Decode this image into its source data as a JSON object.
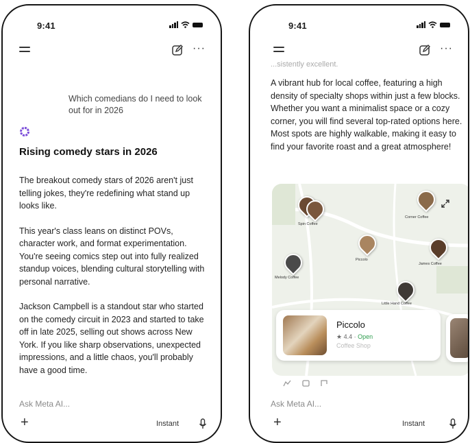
{
  "left_phone": {
    "status_time": "9:41",
    "query": "Which comedians do I need to look out for in 2026",
    "response_title": "Rising comedy stars in 2026",
    "paragraph_1": "The breakout comedy stars of 2026 aren't just telling jokes, they're redefining what stand up looks like.",
    "paragraph_2": "This year's class leans on distinct POVs, character work, and format experimentation. You're seeing comics step out into fully realized standup voices, blending cultural storytelling with personal narrative.",
    "paragraph_3_name": "Jackson Campbell",
    "paragraph_3_rest": " is a standout star who started on the comedy circuit in 2023 and started to take off in late 2025, selling out shows across New York. If you like sharp observations, unexpected impressions, and a little chaos, you'll probably have a good time.",
    "ask_placeholder": "Ask Meta AI...",
    "mode_label": "Instant"
  },
  "right_phone": {
    "status_time": "9:41",
    "faded_text": "...sistently excellent.",
    "description": "A vibrant hub for local coffee, featuring a high density of specialty shops within just a few blocks. Whether you want a minimalist space or a cozy corner, you will find several top-rated options here. Most spots are highly walkable, making it easy to find your favorite roast and a great atmosphere!",
    "map_pins": [
      {
        "label": "Spin Coffee",
        "color": "#6b4a33"
      },
      {
        "label": "Corner Coffee",
        "color": "#8a6a4a"
      },
      {
        "label": "Piccolo",
        "color": "#a98560"
      },
      {
        "label": "James Coffee",
        "color": "#5a3d2a"
      },
      {
        "label": "Melody Coffee",
        "color": "#4a4a4a"
      },
      {
        "label": "Little Hand Coffee",
        "color": "#3f3a36"
      }
    ],
    "card": {
      "name": "Piccolo",
      "rating": "★ 4.4 ·",
      "status": "Open",
      "category": "Coffee Shop"
    },
    "ask_placeholder": "Ask Meta AI...",
    "mode_label": "Instant"
  }
}
